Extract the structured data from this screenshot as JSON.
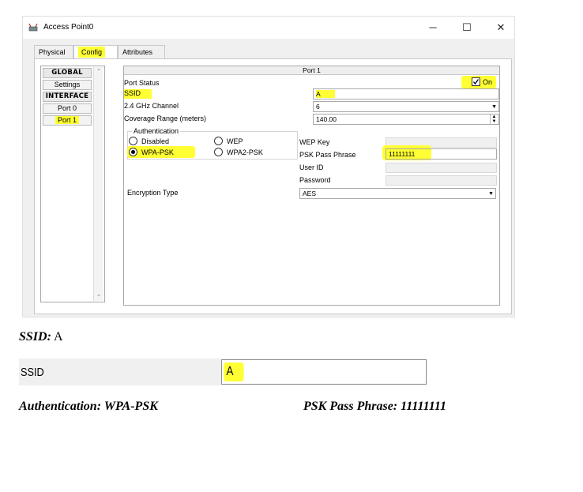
{
  "window": {
    "title": "Access Point0",
    "controls": {
      "minimize": "─",
      "maximize": "☐",
      "close": "✕"
    }
  },
  "tabs": [
    {
      "label": "Physical",
      "active": false
    },
    {
      "label": "Config",
      "active": true
    },
    {
      "label": "Attributes",
      "active": false
    }
  ],
  "sidebar": {
    "items": [
      {
        "label": "GLOBAL",
        "type": "header"
      },
      {
        "label": "Settings",
        "type": "item"
      },
      {
        "label": "INTERFACE",
        "type": "header"
      },
      {
        "label": "Port 0",
        "type": "item"
      },
      {
        "label": "Port 1",
        "type": "item",
        "selected": true
      }
    ]
  },
  "port": {
    "header": "Port 1",
    "status_label": "Port Status",
    "status_on_label": "On",
    "status_checked": true,
    "ssid_label": "SSID",
    "ssid_value": "A",
    "channel_label": "2.4 GHz Channel",
    "channel_value": "6",
    "coverage_label": "Coverage Range (meters)",
    "coverage_value": "140.00",
    "auth_group_label": "Authentication",
    "auth_options": {
      "disabled": "Disabled",
      "wep": "WEP",
      "wpa_psk": "WPA-PSK",
      "wpa2_psk": "WPA2-PSK"
    },
    "auth_selected": "WPA-PSK",
    "wep_key_label": "WEP Key",
    "psk_label": "PSK Pass Phrase",
    "psk_value": "11111111",
    "user_id_label": "User ID",
    "password_label": "Password",
    "encryption_label": "Encryption Type",
    "encryption_value": "AES"
  },
  "annotations": {
    "ssid_caption_label": "SSID:",
    "ssid_caption_value": "A",
    "zoom_ssid_label": "SSID",
    "zoom_ssid_value": "A",
    "auth_caption": "Authentication: WPA-PSK",
    "psk_caption": "PSK Pass Phrase: 11111111"
  },
  "colors": {
    "highlight": "#ffff33",
    "panel_bg": "#f0f0f0"
  }
}
